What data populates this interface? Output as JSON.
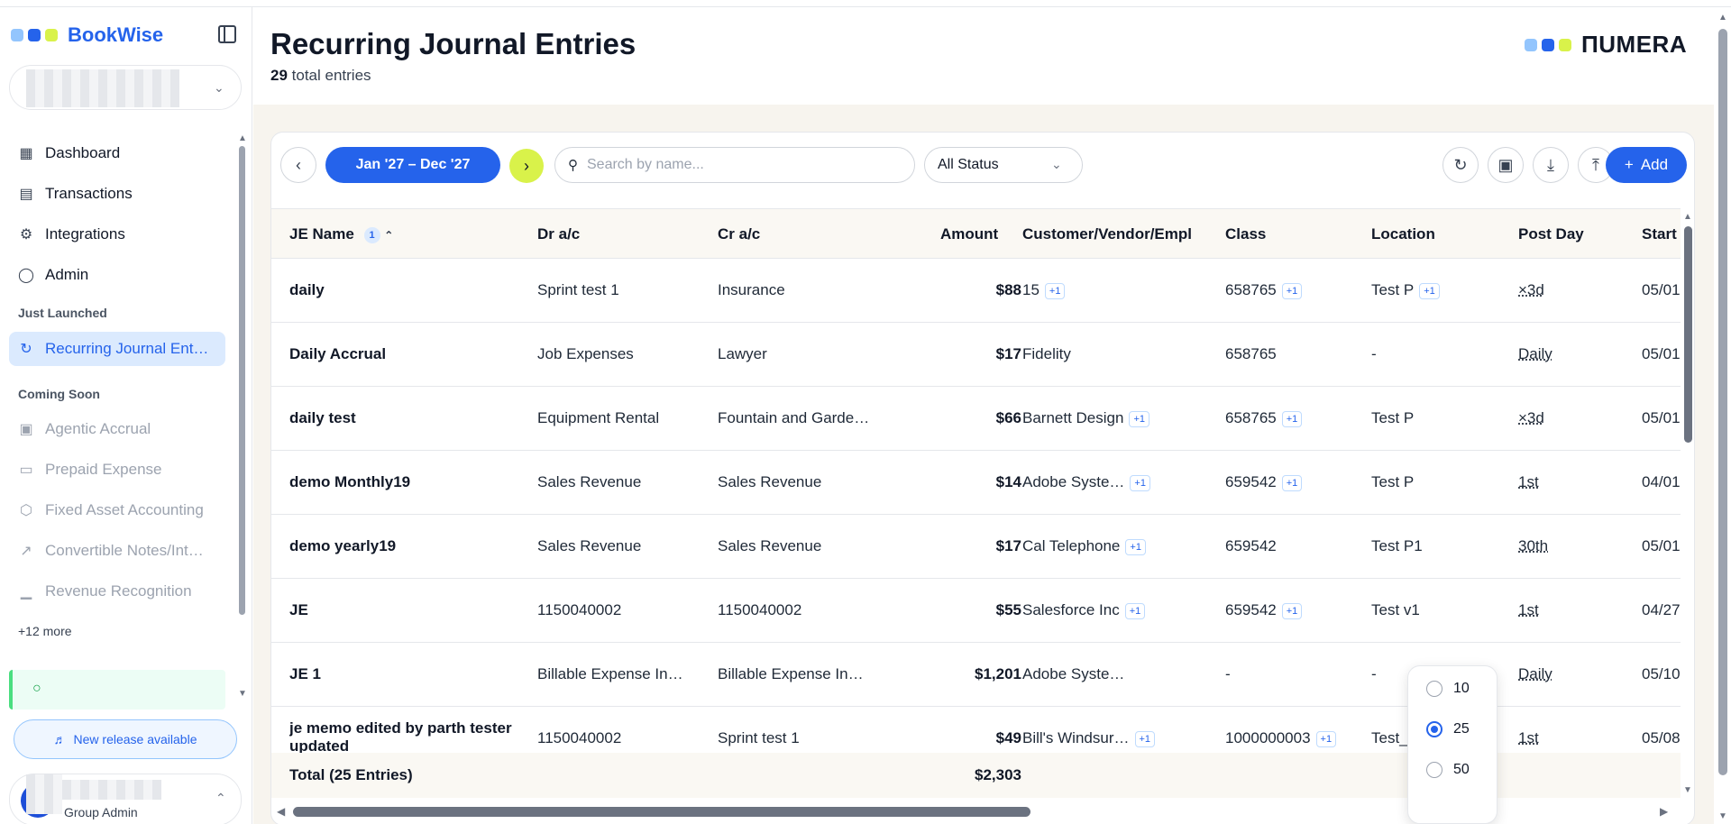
{
  "sidebar": {
    "brand": "BookWise",
    "brand_dots": [
      "#93c5fd",
      "#2563eb",
      "#d9f24a"
    ],
    "nav": [
      {
        "label": "Dashboard",
        "icon": "grid-icon"
      },
      {
        "label": "Transactions",
        "icon": "receipt-icon"
      },
      {
        "label": "Integrations",
        "icon": "gear-icon"
      },
      {
        "label": "Admin",
        "icon": "shield-icon"
      }
    ],
    "just_launched_label": "Just Launched",
    "active_item": {
      "label": "Recurring Journal Ent…",
      "icon": "refresh-icon"
    },
    "coming_soon_label": "Coming Soon",
    "coming_soon": [
      {
        "label": "Agentic Accrual",
        "icon": "robot-icon"
      },
      {
        "label": "Prepaid Expense",
        "icon": "wallet-icon"
      },
      {
        "label": "Fixed Asset Accounting",
        "icon": "box-icon"
      },
      {
        "label": "Convertible Notes/Int…",
        "icon": "trend-icon"
      },
      {
        "label": "Revenue Recognition",
        "icon": "bar-chart-icon"
      }
    ],
    "more_label": "+12 more",
    "release_label": "New release available",
    "user_role": "Group Admin"
  },
  "header": {
    "title": "Recurring Journal Entries",
    "total_count": "29",
    "total_label": "total entries",
    "logo_word": "ΠUMERA",
    "logo_dots": [
      "#93c5fd",
      "#2563eb",
      "#d9f24a"
    ]
  },
  "toolbar": {
    "date_range": "Jan '27 – Dec '27",
    "search_placeholder": "Search by name...",
    "status_value": "All Status",
    "add_label": "Add"
  },
  "table": {
    "columns": [
      "JE Name",
      "Dr a/c",
      "Cr a/c",
      "Amount",
      "Customer/Vendor/Empl",
      "Class",
      "Location",
      "Post Day",
      "Start"
    ],
    "sort_badge": "1",
    "rows": [
      {
        "name": "daily",
        "dr": "Sprint test 1",
        "cr": "Insurance",
        "amount": "$88",
        "cve": "15",
        "cve_more": "+1",
        "class": "658765",
        "class_more": "+1",
        "location": "Test P",
        "loc_more": "+1",
        "post_day": "×3d",
        "start": "05/01"
      },
      {
        "name": "Daily Accrual",
        "dr": "Job Expenses",
        "cr": "Lawyer",
        "amount": "$17",
        "cve": "Fidelity",
        "cve_more": "",
        "class": "658765",
        "class_more": "",
        "location": "-",
        "loc_more": "",
        "post_day": "Daily",
        "start": "05/01"
      },
      {
        "name": "daily test",
        "dr": "Equipment Rental",
        "cr": "Fountain and Garde…",
        "amount": "$66",
        "cve": "Barnett Design",
        "cve_more": "+1",
        "class": "658765",
        "class_more": "+1",
        "location": "Test P",
        "loc_more": "",
        "post_day": "×3d",
        "start": "05/01"
      },
      {
        "name": "demo Monthly19",
        "dr": "Sales Revenue",
        "cr": "Sales Revenue",
        "amount": "$14",
        "cve": "Adobe Syste…",
        "cve_more": "+1",
        "class": "659542",
        "class_more": "+1",
        "location": "Test P",
        "loc_more": "",
        "post_day": "1st",
        "start": "04/01"
      },
      {
        "name": "demo yearly19",
        "dr": "Sales Revenue",
        "cr": "Sales Revenue",
        "amount": "$17",
        "cve": "Cal Telephone",
        "cve_more": "+1",
        "class": "659542",
        "class_more": "",
        "location": "Test P1",
        "loc_more": "",
        "post_day": "30th",
        "start": "05/01"
      },
      {
        "name": "JE",
        "dr": "1150040002",
        "cr": "1150040002",
        "amount": "$55",
        "cve": "Salesforce Inc",
        "cve_more": "+1",
        "class": "659542",
        "class_more": "+1",
        "location": "Test v1",
        "loc_more": "",
        "post_day": "1st",
        "start": "04/27"
      },
      {
        "name": "JE 1",
        "dr": "Billable Expense In…",
        "cr": "Billable Expense In…",
        "amount": "$1,201",
        "cve": "Adobe Syste…",
        "cve_more": "",
        "class": "-",
        "class_more": "",
        "location": "-",
        "loc_more": "",
        "post_day": "Daily",
        "start": "05/10"
      },
      {
        "name": "je memo edited by parth tester updated",
        "dr": "1150040002",
        "cr": "Sprint test 1",
        "amount": "$49",
        "cve": "Bill's Windsur…",
        "cve_more": "+1",
        "class": "1000000003",
        "class_more": "+1",
        "location": "Test_",
        "loc_more": "",
        "post_day": "1st",
        "start": "05/08"
      }
    ],
    "footer_label": "Total (25 Entries)",
    "footer_total": "$2,303"
  },
  "page_size": {
    "options": [
      "10",
      "25",
      "50"
    ],
    "selected": "25"
  }
}
